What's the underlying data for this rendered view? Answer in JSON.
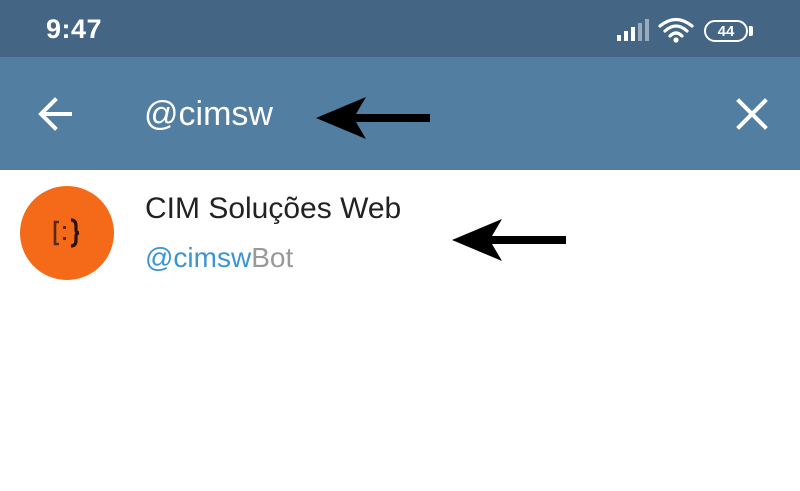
{
  "status_bar": {
    "time": "9:47",
    "battery_level": "44",
    "icons": [
      "signal-icon",
      "wifi-icon",
      "battery-icon"
    ]
  },
  "search": {
    "query": "@cimsw",
    "back_icon": "arrow-left-icon",
    "clear_icon": "close-icon"
  },
  "results": [
    {
      "name": "CIM Soluções Web",
      "username_match": "@cimsw",
      "username_rest": "Bot",
      "avatar_icon": "brackets-logo-icon"
    }
  ],
  "colors": {
    "status_bar": "#446583",
    "header": "#527ea2",
    "avatar": "#f46a18",
    "username_match": "#3b95d3",
    "username_rest": "#999999"
  },
  "annotations": [
    "black-arrow-icon",
    "black-arrow-icon"
  ]
}
